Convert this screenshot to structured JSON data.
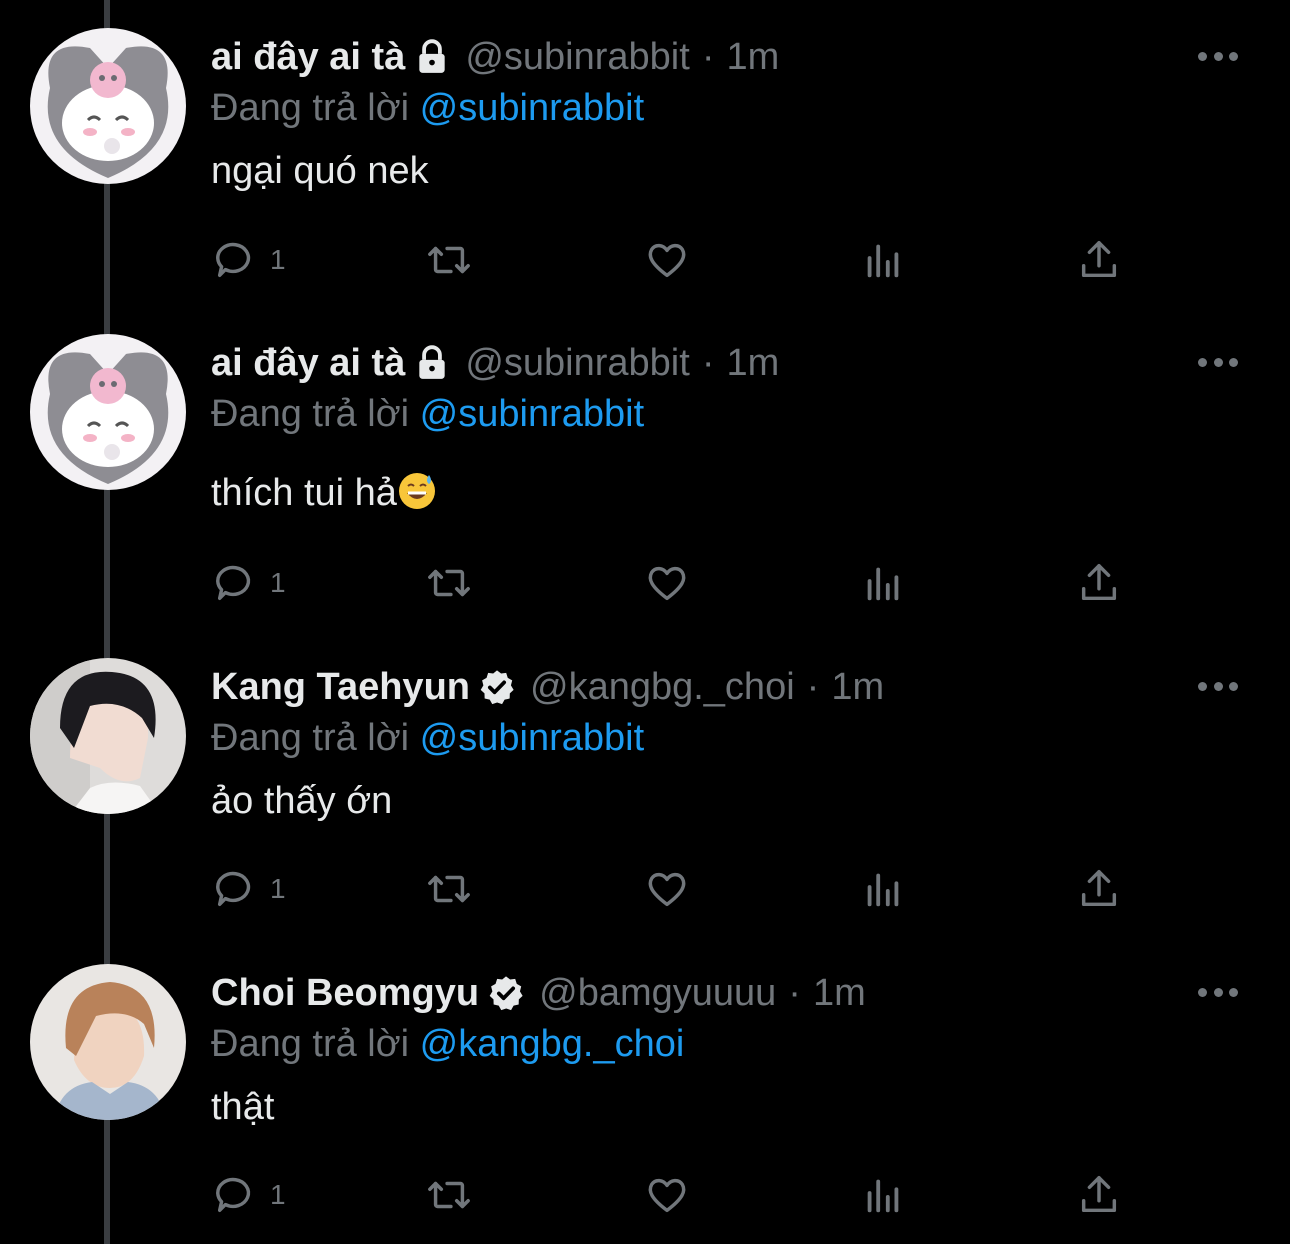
{
  "reply_prefix": "Đang trả lời",
  "tweets": [
    {
      "name": "ai đây ai tà",
      "badge": "lock",
      "handle": "@subinrabbit",
      "dot": "·",
      "time": "1m",
      "reply_to": "@subinrabbit",
      "text": "ngại quó nek",
      "reply_count": "1",
      "avatar": "kuromi-avatar"
    },
    {
      "name": "ai đây ai tà",
      "badge": "lock",
      "handle": "@subinrabbit",
      "dot": "·",
      "time": "1m",
      "reply_to": "@subinrabbit",
      "text": "thích tui hả",
      "emoji": "grinning-sweat-emoji",
      "reply_count": "1",
      "avatar": "kuromi-avatar"
    },
    {
      "name": "Kang Taehyun",
      "badge": "verified",
      "handle": "@kangbg._choi",
      "dot": "·",
      "time": "1m",
      "reply_to": "@subinrabbit",
      "text": "ảo thấy ớn",
      "reply_count": "1",
      "avatar": "profile-photo-dark-hair"
    },
    {
      "name": "Choi Beomgyu",
      "badge": "verified",
      "handle": "@bamgyuuuu",
      "dot": "·",
      "time": "1m",
      "reply_to": "@kangbg._choi",
      "text": "thật",
      "reply_count": "1",
      "avatar": "profile-photo-light-hair"
    }
  ],
  "colors": {
    "background": "#000000",
    "primary_text": "#e7e9ea",
    "secondary_text": "#71767b",
    "link": "#1d9bf0",
    "thread_line": "#3a3d41"
  }
}
